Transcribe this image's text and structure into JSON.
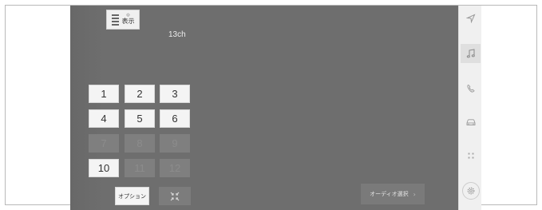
{
  "top_bar": {
    "display_button": {
      "dot": "◎",
      "label": "表示"
    }
  },
  "station": {
    "channel": "13ch"
  },
  "keypad": {
    "keys": [
      {
        "label": "1",
        "enabled": true
      },
      {
        "label": "2",
        "enabled": true
      },
      {
        "label": "3",
        "enabled": true
      },
      {
        "label": "4",
        "enabled": true
      },
      {
        "label": "5",
        "enabled": true
      },
      {
        "label": "6",
        "enabled": true
      },
      {
        "label": "7",
        "enabled": false
      },
      {
        "label": "8",
        "enabled": false
      },
      {
        "label": "9",
        "enabled": false
      },
      {
        "label": "10",
        "enabled": true
      },
      {
        "label": "11",
        "enabled": false
      },
      {
        "label": "12",
        "enabled": false
      }
    ]
  },
  "bottom_bar": {
    "option_label": "オプション",
    "shrink_icon": "minimize-icon",
    "audio_select_label": "オーディオ選択",
    "audio_select_icon": "chevron-right-icon"
  },
  "sidebar": {
    "items": [
      {
        "icon": "navigation-arrow-icon",
        "active": false
      },
      {
        "icon": "music-note-icon",
        "active": true
      },
      {
        "icon": "phone-icon",
        "active": false
      },
      {
        "icon": "car-icon",
        "active": false
      },
      {
        "icon": "apps-grid-icon",
        "active": false
      },
      {
        "icon": "settings-gear-icon",
        "active": false
      }
    ]
  },
  "colors": {
    "screen_bg": "#6e6e6e",
    "key_enabled": "#f4f4f4",
    "key_disabled": "#7f7f7f",
    "sidebar_bg": "#f0f0f0"
  }
}
